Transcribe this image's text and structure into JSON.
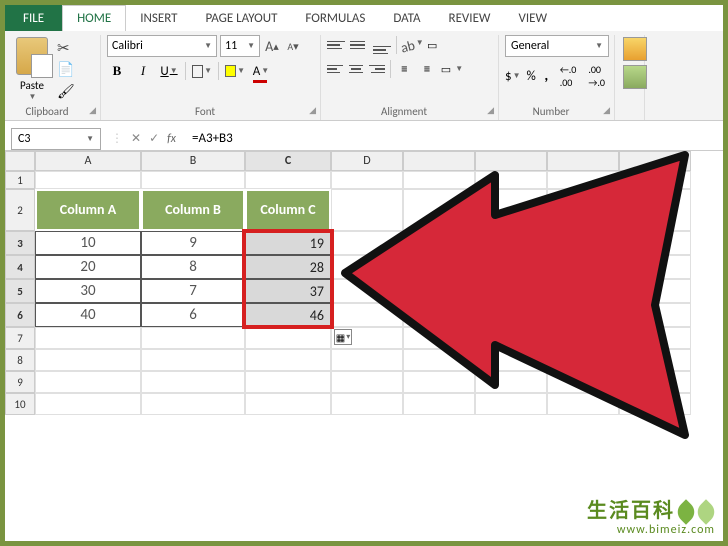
{
  "tabs": {
    "file": "FILE",
    "home": "HOME",
    "insert": "INSERT",
    "page_layout": "PAGE LAYOUT",
    "formulas": "FORMULAS",
    "data": "DATA",
    "review": "REVIEW",
    "view": "VIEW"
  },
  "ribbon": {
    "clipboard": {
      "paste": "Paste",
      "label": "Clipboard"
    },
    "font": {
      "name": "Calibri",
      "size": "11",
      "grow": "A",
      "shrink": "A",
      "bold": "B",
      "italic": "I",
      "underline": "U",
      "font_char": "A",
      "label": "Font"
    },
    "alignment": {
      "label": "Alignment"
    },
    "number": {
      "format": "General",
      "currency": "$",
      "percent": "%",
      "comma": ",",
      "inc_dec": "←.0\n.00",
      "dec_dec": ".00\n→.0",
      "label": "Number"
    }
  },
  "name_box": "C3",
  "formula": "=A3+B3",
  "columns": [
    "A",
    "B",
    "C",
    "D"
  ],
  "row_numbers": [
    1,
    2,
    3,
    4,
    5,
    6,
    7,
    8,
    9,
    10
  ],
  "table": {
    "headers": {
      "a": "Column A",
      "b": "Column B",
      "c": "Column C"
    },
    "rows": [
      {
        "a": "10",
        "b": "9",
        "c": "19"
      },
      {
        "a": "20",
        "b": "8",
        "c": "28"
      },
      {
        "a": "30",
        "b": "7",
        "c": "37"
      },
      {
        "a": "40",
        "b": "6",
        "c": "46"
      }
    ]
  },
  "watermark": {
    "line1": "生活百科",
    "line2": "www.bimeiz.com"
  }
}
